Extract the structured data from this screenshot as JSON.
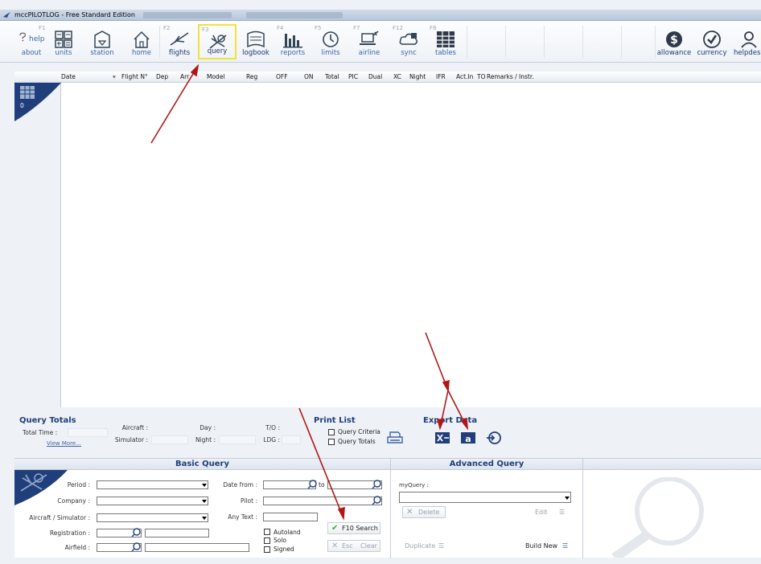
{
  "window": {
    "title": "mccPILOTLOG - Free Standard Edition"
  },
  "toolbar": {
    "items": [
      {
        "key": "F1",
        "label": "help",
        "sub": "about"
      },
      {
        "key": "",
        "label": "units"
      },
      {
        "key": "",
        "label": "station"
      },
      {
        "key": "",
        "label": "home"
      },
      {
        "key": "F2",
        "label": "flights"
      },
      {
        "key": "F3",
        "label": "query"
      },
      {
        "key": "",
        "label": "logbook"
      },
      {
        "key": "F4",
        "label": "reports"
      },
      {
        "key": "F5",
        "label": "limits"
      },
      {
        "key": "F7",
        "label": "airline"
      },
      {
        "key": "F12",
        "label": "sync"
      },
      {
        "key": "F8",
        "label": "tables"
      },
      {
        "key": "",
        "label": "allowance"
      },
      {
        "key": "",
        "label": "currency"
      },
      {
        "key": "",
        "label": "helpdes"
      }
    ]
  },
  "columns": [
    "Date",
    "Flight N°",
    "Dep",
    "Arr",
    "Model",
    "Reg",
    "OFF",
    "ON",
    "Total",
    "PIC",
    "Dual",
    "XC",
    "Night",
    "IFR",
    "Act.In",
    "TO",
    "Remarks / Instr."
  ],
  "grid": {
    "row_count": "0"
  },
  "query_totals": {
    "title": "Query Totals",
    "total_time": "Total Time :",
    "view_more": "View More...",
    "aircraft": "Aircraft :",
    "simulator": "Simulator :",
    "day": "Day :",
    "night": "Night :",
    "to": "T/O :",
    "ldg": "LDG :"
  },
  "print_list": {
    "title": "Print List",
    "criteria": "Query Criteria",
    "totals": "Query Totals"
  },
  "export": {
    "title": "Export Data"
  },
  "basic_query": {
    "title": "Basic Query",
    "period": "Period :",
    "company": "Company :",
    "aircraft": "Aircraft / Simulator :",
    "registration": "Registration :",
    "airfield": "Airfield :",
    "date_from": "Date from :",
    "to": "to",
    "pilot": "Pilot :",
    "any_text": "Any Text :",
    "autoland": "Autoland",
    "solo": "Solo",
    "signed": "Signed",
    "search": "F10  Search",
    "esc": "Esc",
    "clear": "Clear"
  },
  "advanced_query": {
    "title": "Advanced Query",
    "myquery": "myQuery :",
    "delete": "Delete",
    "edit": "Edit",
    "duplicate": "Duplicate",
    "build_new": "Build New"
  },
  "colors": {
    "accent": "#1f3e7a",
    "link": "#3a66a8",
    "highlight": "#f1e33a",
    "arrow": "#b01818",
    "search_check": "#3aa63a"
  }
}
